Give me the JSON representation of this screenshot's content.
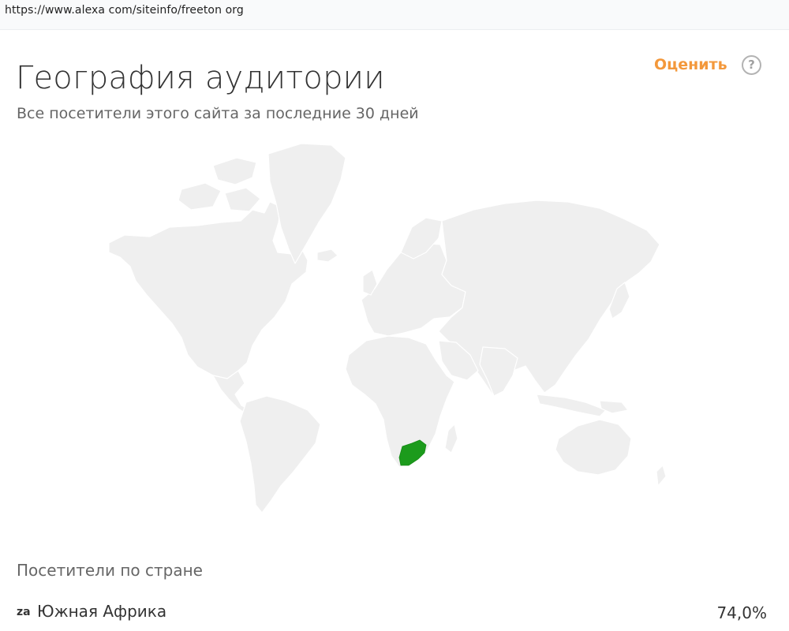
{
  "browser": {
    "url": "https://www.alexa com/siteinfo/freeton org"
  },
  "header": {
    "title": "География аудитории",
    "subtitle": "Все посетители этого сайта за последние 30 дней",
    "rate_label": "Оценить",
    "help_glyph": "?"
  },
  "map": {
    "land_color": "#efefef",
    "highlight_color": "#1c9b1c",
    "highlighted_country": "Южная Африка"
  },
  "visitors_by_country": {
    "label": "Посетители по стране",
    "rows": [
      {
        "code": "za",
        "country": "Южная Африка",
        "percent": "74,0%"
      }
    ]
  },
  "colors": {
    "accent": "#f3983b",
    "text": "#333333",
    "muted": "#666666"
  }
}
